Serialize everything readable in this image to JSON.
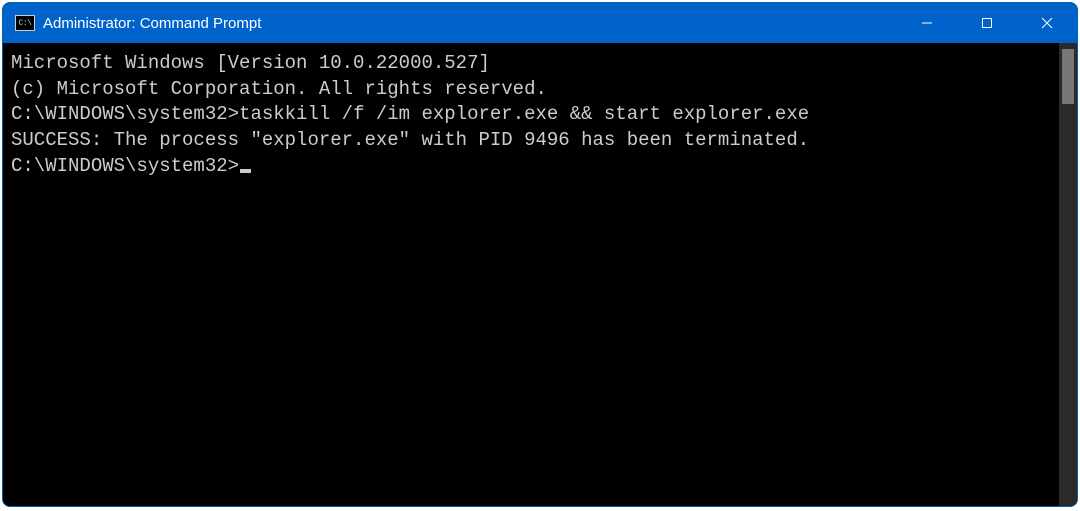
{
  "titlebar": {
    "icon_text": "C:\\",
    "title": "Administrator: Command Prompt"
  },
  "terminal": {
    "line1": "Microsoft Windows [Version 10.0.22000.527]",
    "line2": "(c) Microsoft Corporation. All rights reserved.",
    "blank1": "",
    "prompt1": "C:\\WINDOWS\\system32>",
    "command1": "taskkill /f /im explorer.exe && start explorer.exe",
    "output1": "SUCCESS: The process \"explorer.exe\" with PID 9496 has been terminated.",
    "blank2": "",
    "prompt2": "C:\\WINDOWS\\system32>"
  }
}
